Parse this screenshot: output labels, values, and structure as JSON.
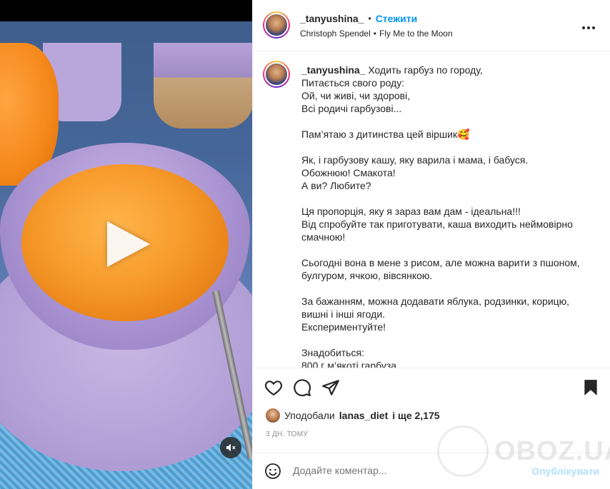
{
  "media": {
    "play_icon": "play-icon",
    "mute_icon": "speaker-muted-icon"
  },
  "post": {
    "author": "_tanyushina_",
    "follow_label": "Стежити",
    "separator": "•",
    "audio": {
      "artist": "Christoph Spendel",
      "dot": "•",
      "track": "Fly Me to the Moon"
    },
    "more_icon": "more-options-icon",
    "caption": {
      "user": "_tanyushina_",
      "text": " Ходить гарбуз по городу,\nПитається свого роду:\nОй, чи живі, чи здорові,\nВсі родичі гарбузові...\n\nПам’ятаю з дитинства цей віршик🥰\n\nЯк, і гарбузову кашу, яку варила і мама, і бабуся.\nОбожнюю! Смакота!\nА ви? Любите?\n\nЦя пропорція, яку я зараз вам дам - ідеальна!!!\nВід спробуйте так приготувати, каша виходить неймовірно смачною!\n\nСьогодні вона в мене з рисом, але можна варити з пшоном, булгуром, ячкою, вівсянкою.\n\nЗа бажанням, можна додавати яблука, родзинки, корицю, вишні і інші ягоди.\nЕкспериментуйте!\n\nЗнадобиться:\n800 г м’якоті гарбуза"
    }
  },
  "actions": {
    "like_icon": "heart-icon",
    "comment_icon": "comment-icon",
    "share_icon": "share-icon",
    "save_icon": "bookmark-icon"
  },
  "likes": {
    "prefix": "Уподобали",
    "user": "lanas_diet",
    "suffix": "і ще 2,175"
  },
  "date": "3 ДН. ТОМУ",
  "comment": {
    "placeholder": "Додайте коментар...",
    "publish_label": "Опублікувати",
    "emoji_icon": "emoji-icon"
  },
  "watermark": {
    "text": "OBOZ.UA"
  },
  "colors": {
    "accent": "#0095f6",
    "publish_disabled": "#b2dffc",
    "muted_text": "#8e8e8e"
  }
}
